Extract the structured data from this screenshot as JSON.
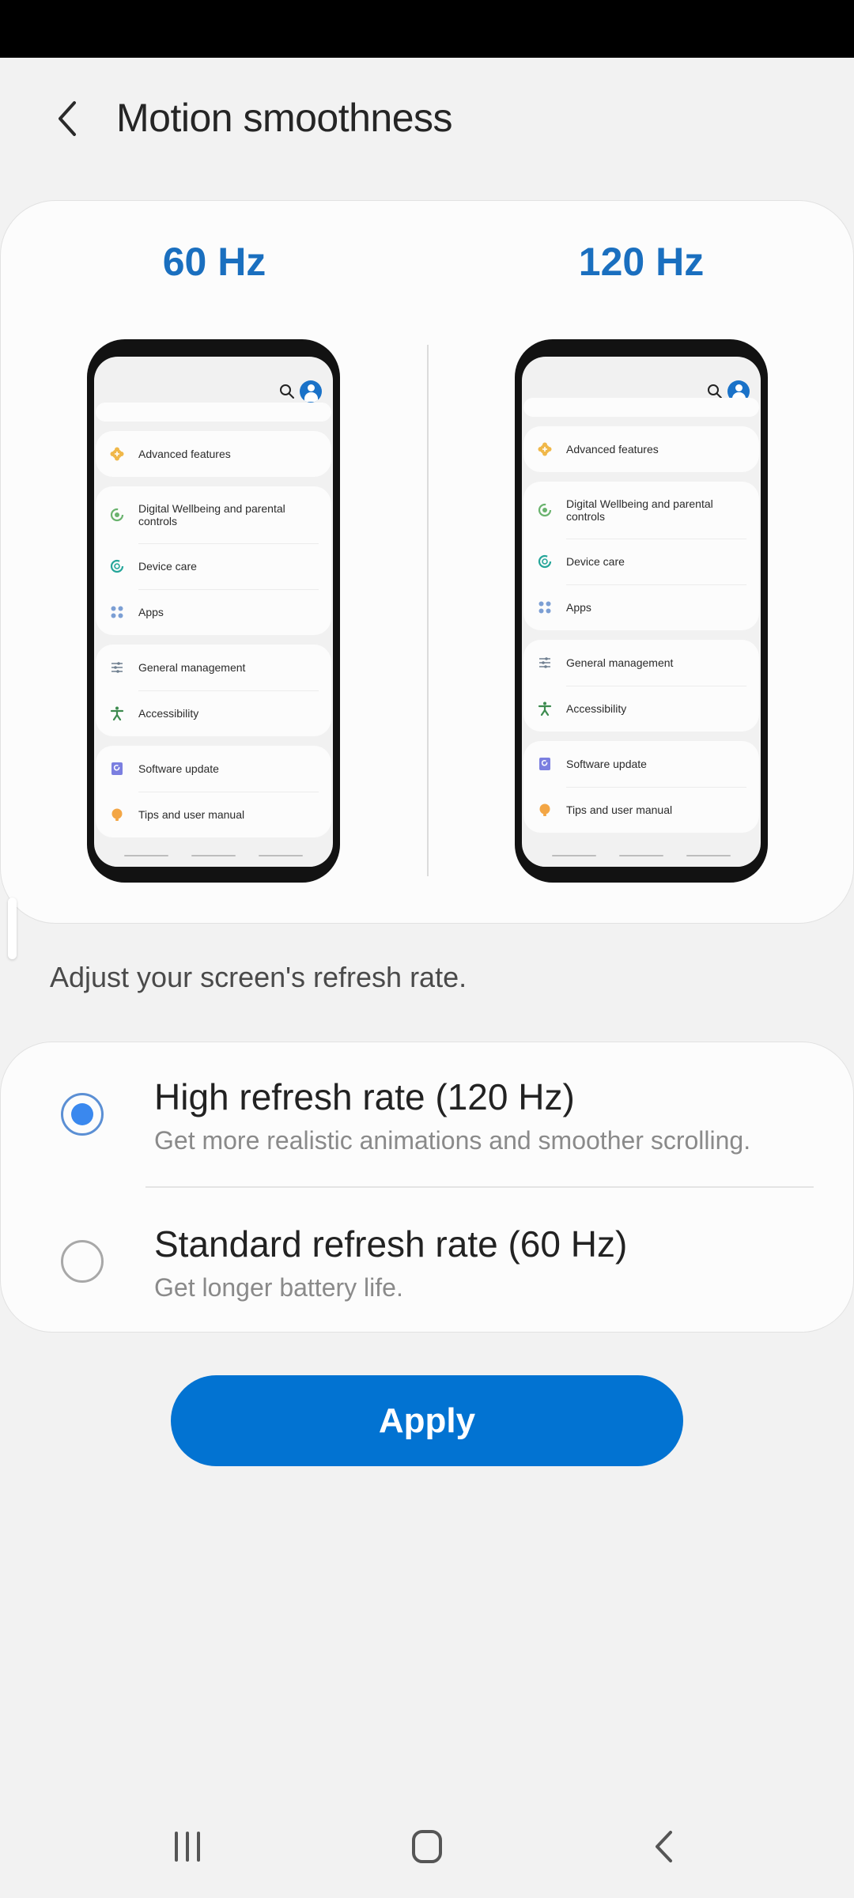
{
  "header": {
    "title": "Motion smoothness",
    "back_icon": "chevron-left-icon"
  },
  "preview": {
    "left_label": "60 Hz",
    "right_label": "120 Hz",
    "mockup": {
      "search_icon": "search-icon",
      "avatar_icon": "profile-avatar-icon",
      "groups": [
        {
          "items": [
            {
              "label": "Advanced features",
              "icon": "advanced-features-icon",
              "color": "#f0b84a"
            }
          ]
        },
        {
          "items": [
            {
              "label": "Digital Wellbeing and parental controls",
              "icon": "digital-wellbeing-icon",
              "color": "#6ab36e"
            },
            {
              "label": "Device care",
              "icon": "device-care-icon",
              "color": "#26a69a"
            },
            {
              "label": "Apps",
              "icon": "apps-icon",
              "color": "#7c9fd4"
            }
          ]
        },
        {
          "items": [
            {
              "label": "General management",
              "icon": "general-management-icon",
              "color": "#6f7f90"
            },
            {
              "label": "Accessibility",
              "icon": "accessibility-icon",
              "color": "#3d8b4f"
            }
          ]
        },
        {
          "items": [
            {
              "label": "Software update",
              "icon": "software-update-icon",
              "color": "#7b7fe0"
            },
            {
              "label": "Tips and user manual",
              "icon": "tips-icon",
              "color": "#f3a645"
            }
          ]
        }
      ]
    }
  },
  "description": "Adjust your screen's refresh rate.",
  "options": [
    {
      "title": "High refresh rate (120 Hz)",
      "subtitle": "Get more realistic animations and smoother scrolling.",
      "selected": true
    },
    {
      "title": "Standard refresh rate (60 Hz)",
      "subtitle": "Get longer battery life.",
      "selected": false
    }
  ],
  "apply_label": "Apply",
  "nav": {
    "recents_icon": "recents-icon",
    "home_icon": "home-icon",
    "back_icon": "back-icon"
  },
  "colors": {
    "accent": "#0273d2",
    "hz_label": "#1a6fbf",
    "radio_selected": "#3a88ee",
    "background": "#f2f2f2"
  }
}
